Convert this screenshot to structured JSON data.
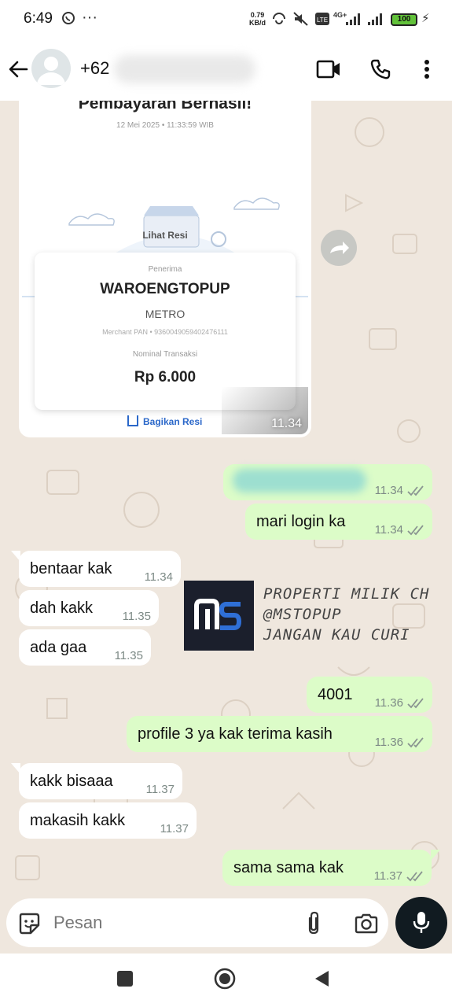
{
  "status_bar": {
    "time": "6:49",
    "net_speed_value": "0.79",
    "net_speed_unit": "KB/d",
    "network_label": "4G+",
    "battery": "100"
  },
  "header": {
    "contact_prefix": "+62"
  },
  "receipt": {
    "title": "Pembayaran Berhasil!",
    "date": "12 Mei 2025 • 11:33:59 WIB",
    "view_receipt": "Lihat Resi",
    "recipient_label": "Penerima",
    "recipient_name": "WAROENGTOPUP",
    "recipient_city": "METRO",
    "merchant_pan": "Merchant PAN • 9360049059402476111",
    "amount_label": "Nominal Transaksi",
    "amount": "Rp 6.000",
    "share_label": "Bagikan Resi",
    "time": "11.34"
  },
  "messages": [
    {
      "dir": "out",
      "text": "",
      "time": "11.34"
    },
    {
      "dir": "out",
      "text": "mari login ka",
      "time": "11.34"
    },
    {
      "dir": "in",
      "text": "bentaar kak",
      "time": "11.34"
    },
    {
      "dir": "in",
      "text": "dah kakk",
      "time": "11.35"
    },
    {
      "dir": "in",
      "text": "ada gaa",
      "time": "11.35"
    },
    {
      "dir": "out",
      "text": "4001",
      "time": "11.36"
    },
    {
      "dir": "out",
      "text": "profile 3 ya kak terima kasih",
      "time": "11.36"
    },
    {
      "dir": "in",
      "text": "kakk bisaaa",
      "time": "11.37"
    },
    {
      "dir": "in",
      "text": "makasih kakk",
      "time": "11.37"
    },
    {
      "dir": "out",
      "text": "sama sama kak",
      "time": "11.37"
    }
  ],
  "watermark": {
    "line1": "PROPERTI MILIK CH",
    "line2": "@MSTOPUP",
    "line3": "JANGAN KAU CURI",
    "logo_text": "MS"
  },
  "input": {
    "placeholder": "Pesan"
  },
  "colors": {
    "outgoing_bubble": "#dcfcc8",
    "incoming_bubble": "#ffffff",
    "chat_background": "#efe7de",
    "read_ticks": "#8a9591",
    "mic_button": "#111b21"
  }
}
